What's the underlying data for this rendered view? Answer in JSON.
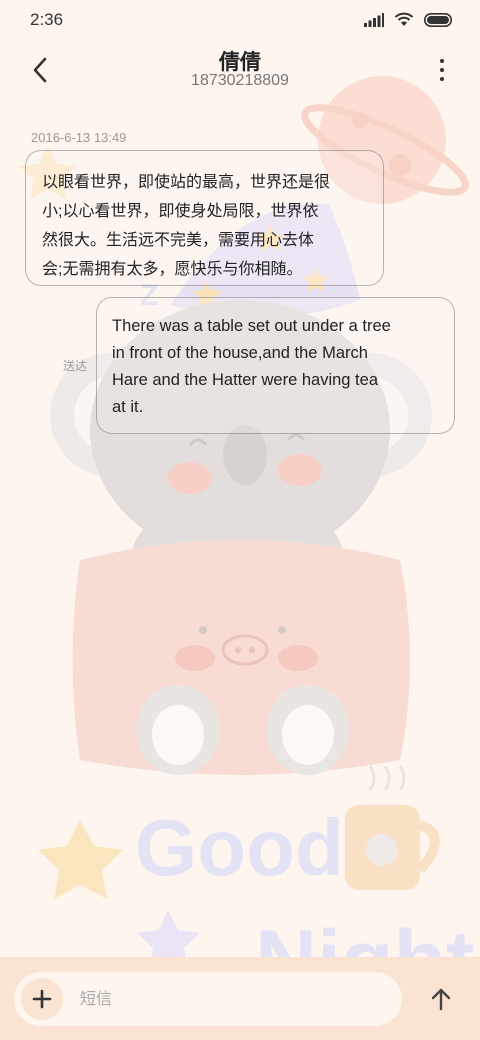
{
  "status_bar": {
    "time": "2:36",
    "icons": [
      "signal-icon",
      "wifi-icon",
      "battery-icon"
    ]
  },
  "header": {
    "contact_name": "倩倩",
    "phone_number": "18730218809",
    "back_icon": "chevron-left-icon",
    "more_icon": "more-vertical-icon"
  },
  "conversation": {
    "timestamp": "2016-6-13 13:49",
    "messages": [
      {
        "direction": "incoming",
        "lines": [
          "以眼看世界，即使站的最高，世界还是很",
          "小;以心看世界，即使身处局限，世界依",
          "然很大。生活远不完美，需要用心去体",
          "会;无需拥有太多，愿快乐与你相随。"
        ]
      },
      {
        "direction": "outgoing",
        "status": "送达",
        "lines": [
          "There was a table set out under a tree",
          "in front of the house,and the March",
          "Hare and the Hatter were having tea",
          "at it."
        ]
      }
    ]
  },
  "input_bar": {
    "placeholder": "短信",
    "value": "",
    "add_icon": "plus-icon",
    "send_icon": "arrow-up-icon"
  },
  "wallpaper": {
    "theme": "koala-good-night",
    "colors": {
      "background": "#fdf5ee",
      "input_bar": "#fbe3d3",
      "pillow": "#f6d3cc",
      "koala": "#e0dbd9",
      "hat": "#e8e2f4",
      "star": "#fae3b9",
      "lettering": "#e4e3f6"
    }
  }
}
